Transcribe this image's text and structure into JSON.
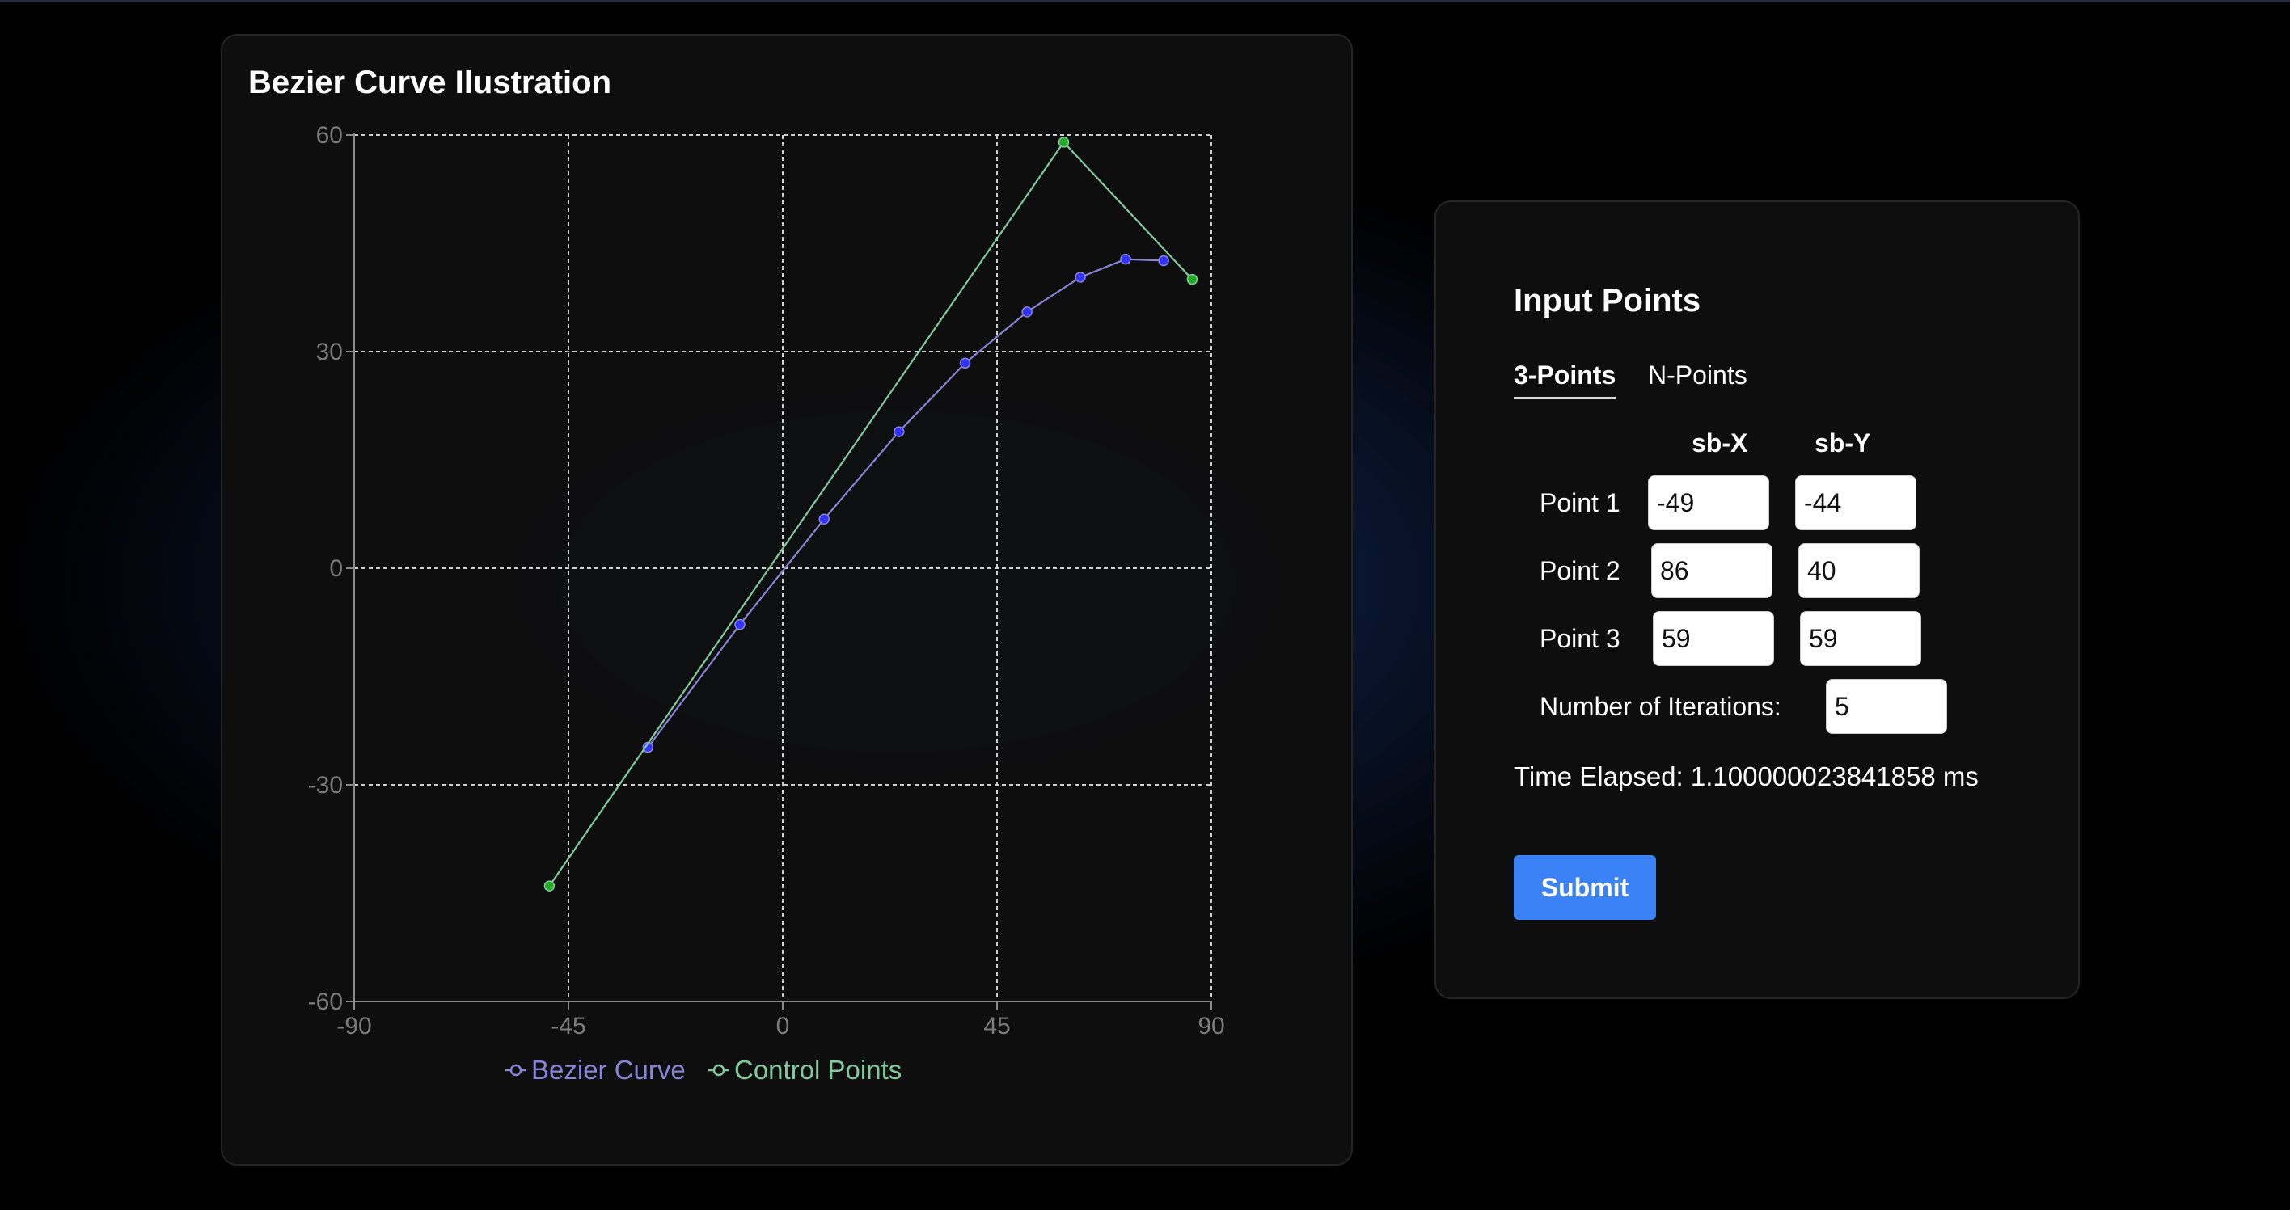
{
  "chart_panel": {
    "title": "Bezier Curve Ilustration"
  },
  "chart_data": {
    "type": "line",
    "xlim": [
      -90,
      90
    ],
    "ylim": [
      -60,
      60
    ],
    "x_ticks": [
      -90,
      -45,
      0,
      45,
      90
    ],
    "y_ticks": [
      60,
      30,
      0,
      -30,
      -60
    ],
    "grid": true,
    "legend_position": "bottom",
    "series": [
      {
        "name": "Bezier Curve",
        "color": "#8884d8",
        "marker_color": "#3333ff",
        "points": [
          {
            "x": -28.3,
            "y": -24.8
          },
          {
            "x": -9,
            "y": -7.8
          },
          {
            "x": 8.7,
            "y": 6.8
          },
          {
            "x": 24.4,
            "y": 18.9
          },
          {
            "x": 38.3,
            "y": 28.4
          },
          {
            "x": 51.3,
            "y": 35.5
          },
          {
            "x": 62.5,
            "y": 40.3
          },
          {
            "x": 72,
            "y": 42.8
          },
          {
            "x": 80,
            "y": 42.6
          }
        ]
      },
      {
        "name": "Control Points",
        "color": "#82ca9d",
        "marker_color": "#22aa22",
        "points": [
          {
            "x": -49,
            "y": -44
          },
          {
            "x": 59,
            "y": 59
          },
          {
            "x": 86,
            "y": 40
          }
        ]
      }
    ]
  },
  "input_panel": {
    "title": "Input Points",
    "tabs": [
      {
        "label": "3-Points",
        "active": true
      },
      {
        "label": "N-Points",
        "active": false
      }
    ],
    "column_headers": {
      "x": "sb-X",
      "y": "sb-Y"
    },
    "points": [
      {
        "label": "Point 1",
        "x": "-49",
        "y": "-44"
      },
      {
        "label": "Point 2",
        "x": "86",
        "y": "40"
      },
      {
        "label": "Point 3",
        "x": "59",
        "y": "59"
      }
    ],
    "iterations_label": "Number of Iterations:",
    "iterations_value": "5",
    "time_elapsed": "Time Elapsed: 1.100000023841858 ms",
    "submit_label": "Submit"
  },
  "colors": {
    "accent": "#3b82f6",
    "bezier": "#8884d8",
    "control": "#82ca9d"
  }
}
